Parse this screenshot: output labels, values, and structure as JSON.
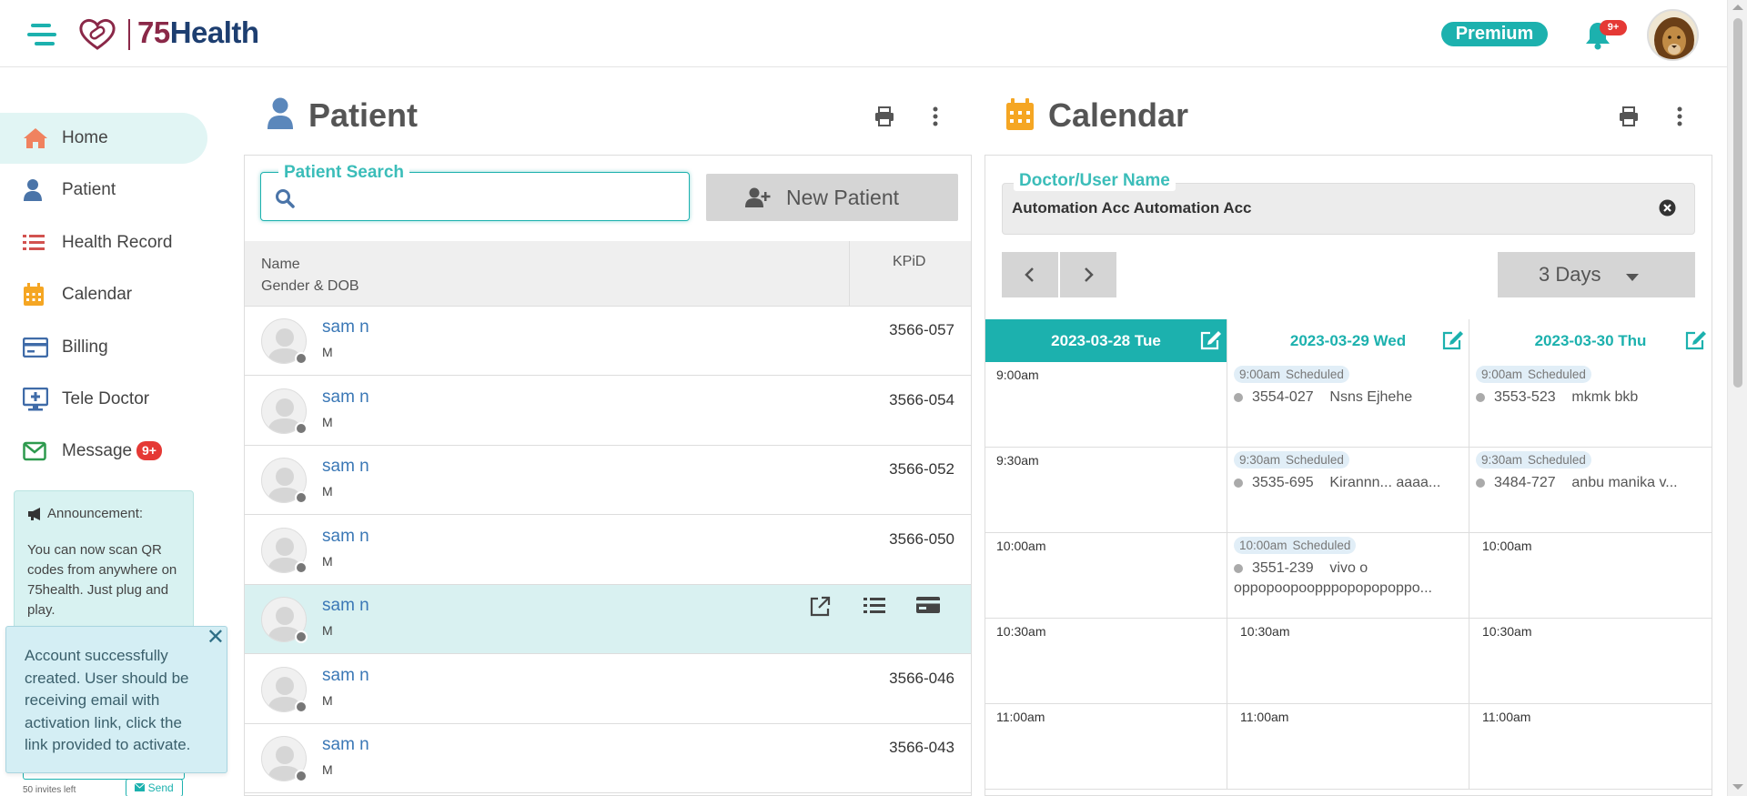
{
  "app": {
    "brand_prefix": "75",
    "brand_suffix": "Health",
    "premium_label": "Premium",
    "notif_badge": "9+"
  },
  "sidebar": {
    "items": [
      {
        "label": "Home",
        "icon": "home-icon",
        "color": "#f0825f",
        "active": true
      },
      {
        "label": "Patient",
        "icon": "user-icon",
        "color": "#4a74a8"
      },
      {
        "label": "Health Record",
        "icon": "list-icon",
        "color": "#d2524f"
      },
      {
        "label": "Calendar",
        "icon": "calendar-icon",
        "color": "#f5a623"
      },
      {
        "label": "Billing",
        "icon": "credit-card-icon",
        "color": "#3f6ba8"
      },
      {
        "label": "Tele Doctor",
        "icon": "monitor-icon",
        "color": "#3f6ba8"
      },
      {
        "label": "Message",
        "icon": "envelope-icon",
        "color": "#2e9a4e",
        "badge": "9+"
      }
    ],
    "announcement": {
      "title": "Announcement:",
      "body": "You can now scan QR codes from anywhere on 75health. Just plug and play."
    },
    "toast": {
      "text": "Account successfully created. User should be receiving email with activation link, click the link provided to activate.",
      "close": "✕"
    },
    "invites_left": "50 invites left",
    "send_label": "Send"
  },
  "patient": {
    "title": "Patient",
    "search_legend": "Patient Search",
    "search_value": "",
    "new_patient_label": "New Patient",
    "col_name": "Name",
    "col_gender": "Gender & DOB",
    "col_id": "KPiD",
    "rows": [
      {
        "name": "sam n",
        "gender": "M",
        "id": "3566-057"
      },
      {
        "name": "sam n",
        "gender": "M",
        "id": "3566-054"
      },
      {
        "name": "sam n",
        "gender": "M",
        "id": "3566-052"
      },
      {
        "name": "sam n",
        "gender": "M",
        "id": "3566-050"
      },
      {
        "name": "sam n",
        "gender": "M",
        "id": "",
        "highlighted": true
      },
      {
        "name": "sam n",
        "gender": "M",
        "id": "3566-046"
      },
      {
        "name": "sam n",
        "gender": "M",
        "id": "3566-043"
      }
    ]
  },
  "calendar": {
    "title": "Calendar",
    "doctor_legend": "Doctor/User Name",
    "doctor_value": "Automation Acc Automation Acc",
    "days_label": "3 Days",
    "days": [
      {
        "label": "2023-03-28 Tue",
        "active": true
      },
      {
        "label": "2023-03-29 Wed"
      },
      {
        "label": "2023-03-30 Thu"
      }
    ],
    "times": [
      "9:00am",
      "9:30am",
      "10:00am",
      "10:30am",
      "11:00am"
    ],
    "slots": [
      [
        {
          "time": "9:00am"
        },
        {
          "time": "9:00am",
          "status": "Scheduled",
          "kpid": "3554-027",
          "patient": "Nsns Ejhehe"
        },
        {
          "time": "9:00am",
          "status": "Scheduled",
          "kpid": "3553-523",
          "patient": "mkmk bkb"
        }
      ],
      [
        {
          "time": "9:30am"
        },
        {
          "time": "9:30am",
          "status": "Scheduled",
          "kpid": "3535-695",
          "patient": "Kirannn...  aaaa..."
        },
        {
          "time": "9:30am",
          "status": "Scheduled",
          "kpid": "3484-727",
          "patient": "anbu manika v..."
        }
      ],
      [
        {
          "time": "10:00am"
        },
        {
          "time": "10:00am",
          "status": "Scheduled",
          "kpid": "3551-239",
          "patient": "vivo o",
          "patient_line2": "oppopoopoopppopopopoppo..."
        },
        {
          "time": "10:00am"
        }
      ],
      [
        {
          "time": "10:30am"
        },
        {
          "time": "10:30am"
        },
        {
          "time": "10:30am"
        }
      ],
      [
        {
          "time": "11:00am"
        },
        {
          "time": "11:00am"
        },
        {
          "time": "11:00am"
        }
      ]
    ]
  },
  "colors": {
    "accent": "#1cb1ae",
    "brand_dark": "#1d3e70",
    "brand_red": "#8a2848",
    "badge": "#e53935",
    "link": "#3b78b6"
  }
}
